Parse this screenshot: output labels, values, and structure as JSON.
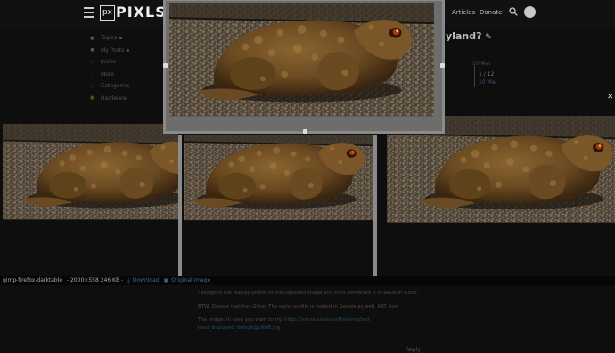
{
  "header": {
    "logo_box": "px",
    "logo_text": "PIXLS",
    "nav": [
      "Articles",
      "Donate"
    ]
  },
  "sidebar": {
    "items": [
      {
        "label": "Topics",
        "icon": "topics-icon",
        "dot": true
      },
      {
        "label": "My Posts",
        "icon": "user-icon",
        "dot": true
      },
      {
        "label": "Invite",
        "icon": "invite-icon",
        "dot": false
      },
      {
        "label": "More",
        "icon": "more-icon",
        "dot": false
      },
      {
        "label": "Categories",
        "icon": "categories-icon",
        "dot": false
      },
      {
        "label": "Hardware",
        "icon": "hardware-icon",
        "dot": false
      }
    ]
  },
  "topic": {
    "title_visible": "yland?",
    "timeline": {
      "top": "10 Mar",
      "progress": "1 / 12",
      "bottom": "10 Mar"
    }
  },
  "lightbox": {
    "filename": "gimp-firefox-darktable",
    "info": "- 2000×558 246 KB -",
    "download": "Download",
    "original": "Original image"
  },
  "post": {
    "p1": "I assigned the display profile to the captured image and then converted it to sRGB in Gimp.",
    "p2": "BTW, Geeqie matches Gimp. The same profile is loaded in Geeqie as well. ART, too.",
    "p3_prefix": "The image, in case you want to try:",
    "p3_link1": "https://vernacularis.io/files/img/test",
    "p3_link2": "toad_displayed_default@sRGB.jpg",
    "reply": "Reply"
  },
  "colors": {
    "accent": "#1e6e5e",
    "link": "#264a5e"
  }
}
